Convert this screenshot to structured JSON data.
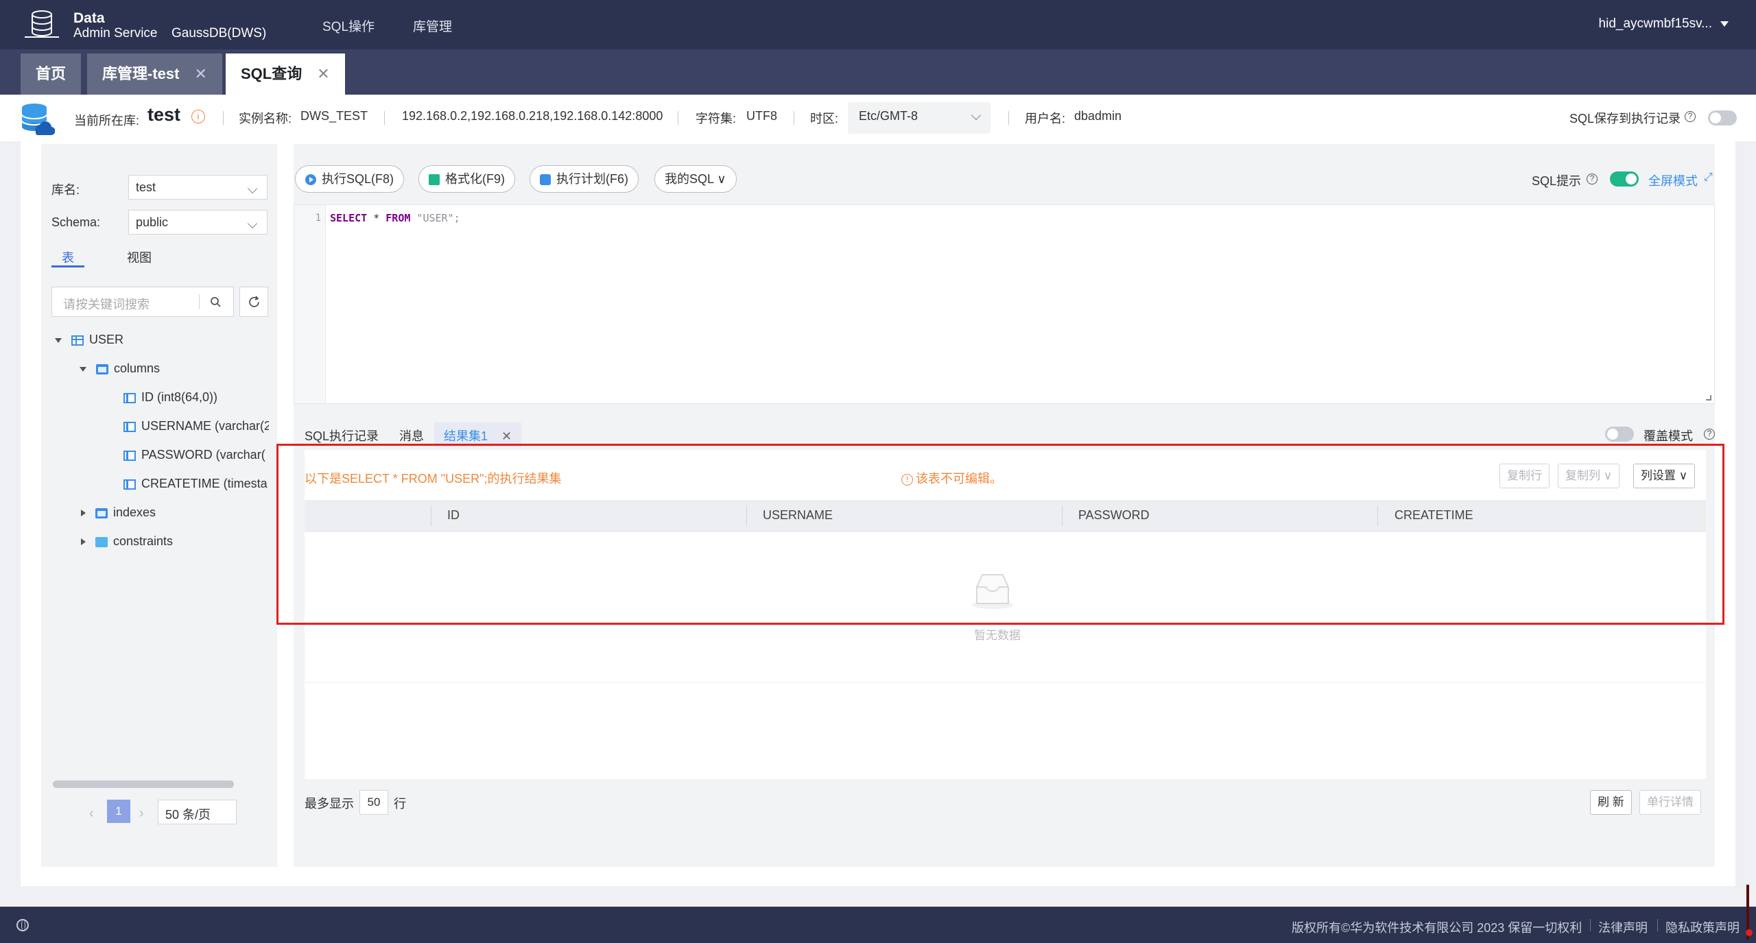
{
  "topbar": {
    "brand_line1": "Data",
    "brand_line2": "Admin Service",
    "brand_product": "GaussDB(DWS)",
    "nav": [
      "SQL操作",
      "库管理"
    ],
    "user": "hid_aycwmbf15sv..."
  },
  "tabs": [
    {
      "label": "首页",
      "closable": false
    },
    {
      "label": "库管理-test",
      "closable": true
    },
    {
      "label": "SQL查询",
      "closable": true,
      "active": true
    }
  ],
  "info": {
    "current_db_label": "当前所在库:",
    "current_db": "test",
    "instance_label": "实例名称:",
    "instance": "DWS_TEST",
    "hosts": "192.168.0.2,192.168.0.218,192.168.0.142:8000",
    "charset_label": "字符集:",
    "charset": "UTF8",
    "tz_label": "时区:",
    "tz": "Etc/GMT-8",
    "user_label": "用户名:",
    "user": "dbadmin",
    "save_record_label": "SQL保存到执行记录"
  },
  "left": {
    "db_label": "库名:",
    "db_value": "test",
    "schema_label": "Schema:",
    "schema_value": "public",
    "tab_table": "表",
    "tab_view": "视图",
    "search_placeholder": "请按关键词搜索",
    "tree": {
      "table": "USER",
      "columns_label": "columns",
      "columns": [
        "ID (int8(64,0))",
        "USERNAME (varchar(2",
        "PASSWORD (varchar(",
        "CREATETIME (timesta"
      ],
      "indexes_label": "indexes",
      "constraints_label": "constraints"
    },
    "page": "1",
    "page_size": "50 条/页"
  },
  "toolbar": {
    "exec": "执行SQL(F8)",
    "format": "格式化(F9)",
    "plan": "执行计划(F6)",
    "my_sql": "我的SQL",
    "sql_hint": "SQL提示",
    "fullscreen": "全屏模式"
  },
  "editor": {
    "line": "1",
    "kw1": "SELECT",
    "star": " * ",
    "kw2": "FROM",
    "str": " \"USER\";"
  },
  "bottom_tabs": {
    "history": "SQL执行记录",
    "message": "消息",
    "result": "结果集1",
    "overwrite": "覆盖模式"
  },
  "result": {
    "title": "以下是SELECT * FROM \"USER\";的执行结果集",
    "warning": "该表不可编辑。",
    "copy_row": "复制行",
    "copy_col": "复制列",
    "col_settings": "列设置",
    "columns": [
      "ID",
      "USERNAME",
      "PASSWORD",
      "CREATETIME"
    ],
    "empty": "暂无数据",
    "max_show": "最多显示",
    "max_rows": "50",
    "rows_unit": "行",
    "refresh": "刷 新",
    "row_detail": "单行详情"
  },
  "footer": {
    "copyright": "版权所有©华为软件技术有限公司 2023 保留一切权利",
    "legal": "法律声明",
    "privacy": "隐私政策声明"
  }
}
